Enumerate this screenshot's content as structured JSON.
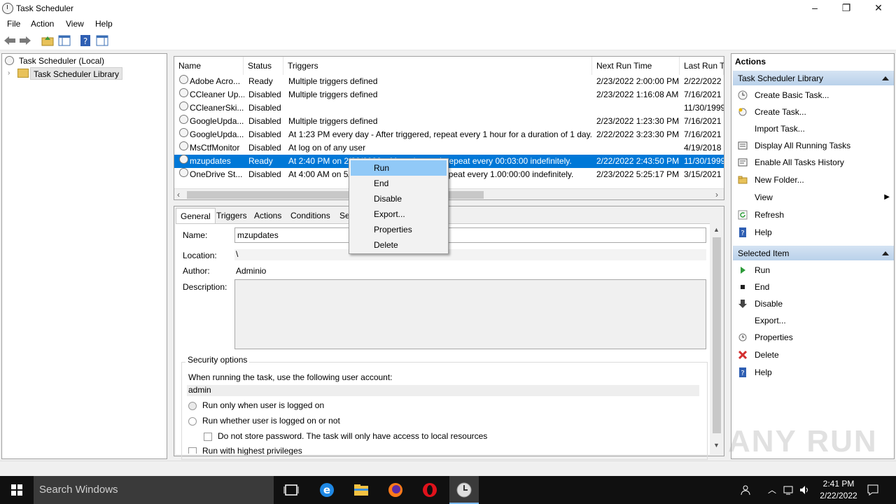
{
  "window": {
    "title": "Task Scheduler",
    "controls": [
      "–",
      "❐",
      "✕"
    ]
  },
  "menu": [
    "File",
    "Action",
    "View",
    "Help"
  ],
  "tree": {
    "root": "Task Scheduler (Local)",
    "library": "Task Scheduler Library"
  },
  "tasklist": {
    "columns": [
      "Name",
      "Status",
      "Triggers",
      "Next Run Time",
      "Last Run Ti"
    ],
    "rows": [
      {
        "name": "Adobe Acro...",
        "status": "Ready",
        "triggers": "Multiple triggers defined",
        "next": "2/23/2022 2:00:00 PM",
        "last": "2/22/2022"
      },
      {
        "name": "CCleaner Up...",
        "status": "Disabled",
        "triggers": "Multiple triggers defined",
        "next": "2/23/2022 1:16:08 AM",
        "last": "7/16/2021"
      },
      {
        "name": "CCleanerSki...",
        "status": "Disabled",
        "triggers": "",
        "next": "",
        "last": "11/30/1999"
      },
      {
        "name": "GoogleUpda...",
        "status": "Disabled",
        "triggers": "Multiple triggers defined",
        "next": "2/23/2022 1:23:30 PM",
        "last": "7/16/2021"
      },
      {
        "name": "GoogleUpda...",
        "status": "Disabled",
        "triggers": "At 1:23 PM every day - After triggered, repeat every 1 hour for a duration of 1 day.",
        "next": "2/22/2022 3:23:30 PM",
        "last": "7/16/2021"
      },
      {
        "name": "MsCtfMonitor",
        "status": "Disabled",
        "triggers": "At log on of any user",
        "next": "",
        "last": "4/19/2018"
      },
      {
        "name": "mzupdates",
        "status": "Ready",
        "triggers": "At 2:40 PM on 2/22/2022 - After triggered, repeat every 00:03:00 indefinitely.",
        "next": "2/22/2022 2:43:50 PM",
        "last": "11/30/1999"
      },
      {
        "name": "OneDrive St...",
        "status": "Disabled",
        "triggers": "At 4:00 AM on 5/1/1992 - After triggered, repeat every 1.00:00:00 indefinitely.",
        "next": "2/23/2022 5:25:17 PM",
        "last": "3/15/2021"
      }
    ]
  },
  "details": {
    "tabs": [
      "General",
      "Triggers",
      "Actions",
      "Conditions",
      "Set"
    ],
    "name_label": "Name:",
    "name_value": "mzupdates",
    "location_label": "Location:",
    "location_value": "\\",
    "author_label": "Author:",
    "author_value": "Adminio",
    "description_label": "Description:",
    "security_title": "Security options",
    "account_prompt": "When running the task, use the following user account:",
    "account_value": "admin",
    "radio1": "Run only when user is logged on",
    "radio2": "Run whether user is logged on or not",
    "nopassword": "Do not store password.  The task will only have access to local resources",
    "highest": "Run with highest privileges"
  },
  "context_menu": [
    "Run",
    "End",
    "Disable",
    "Export...",
    "Properties",
    "Delete"
  ],
  "actions": {
    "header": "Actions",
    "section1": "Task Scheduler Library",
    "library_items": [
      "Create Basic Task...",
      "Create Task...",
      "Import Task...",
      "Display All Running Tasks",
      "Enable All Tasks History",
      "New Folder...",
      "View",
      "Refresh",
      "Help"
    ],
    "section2": "Selected Item",
    "item_actions": [
      "Run",
      "End",
      "Disable",
      "Export...",
      "Properties",
      "Delete",
      "Help"
    ]
  },
  "taskbar": {
    "search": "Search Windows",
    "time": "2:41 PM",
    "date": "2/22/2022"
  },
  "watermark": "ANY RUN",
  "colors": {
    "selection": "#0078d7",
    "context_highlight": "#91c9f7",
    "section_header": "#c6d9ef",
    "delete_red": "#d32f2f"
  }
}
